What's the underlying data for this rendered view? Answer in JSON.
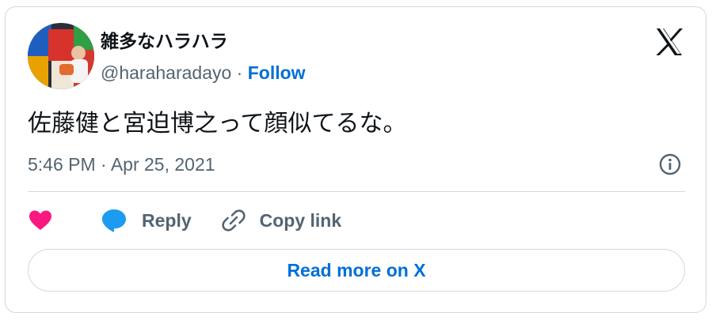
{
  "user": {
    "display_name": "雑多なハラハラ",
    "handle": "@haraharadayo",
    "separator": " · ",
    "follow_label": "Follow"
  },
  "tweet": {
    "text": "佐藤健と宮迫博之って顔似てるな。",
    "timestamp": "5:46 PM · Apr 25, 2021"
  },
  "actions": {
    "like_icon": "heart-icon",
    "reply_label": "Reply",
    "reply_icon": "speech-bubble-icon",
    "copy_link_label": "Copy link",
    "copy_link_icon": "link-icon"
  },
  "read_more": {
    "label": "Read more on X"
  },
  "colors": {
    "accent": "#006fd6",
    "heart": "#f91880",
    "reply_bubble": "#1d9bf0",
    "secondary_text": "#536471",
    "border": "#cfd9de"
  }
}
